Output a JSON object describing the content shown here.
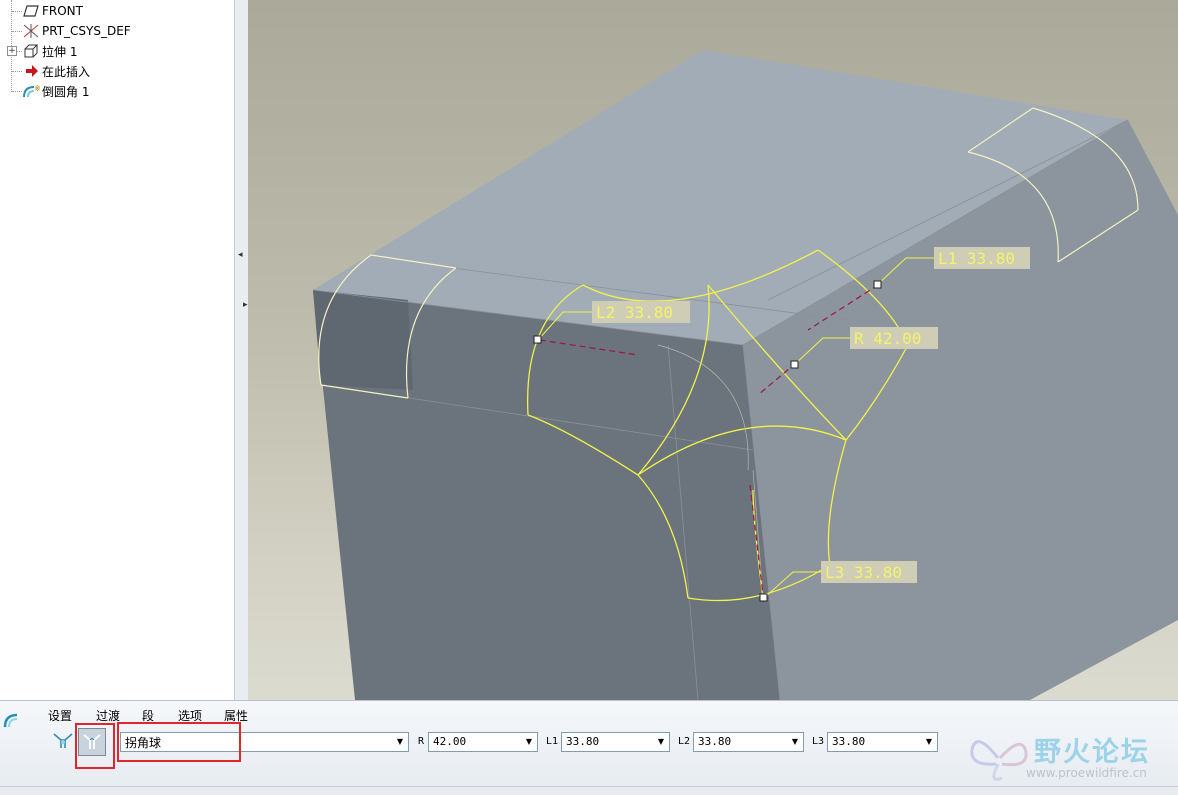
{
  "model_tree": {
    "items": [
      {
        "label": "FRONT",
        "icon": "datum-plane-icon"
      },
      {
        "label": "PRT_CSYS_DEF",
        "icon": "coordinate-system-icon"
      },
      {
        "label": "拉伸 1",
        "icon": "extrude-icon"
      },
      {
        "label": "在此插入",
        "icon": "insert-here-arrow-icon"
      },
      {
        "label": "倒圆角 1",
        "icon": "round-feature-icon"
      }
    ]
  },
  "viewport": {
    "dimensions": [
      {
        "label": "L1 33.80"
      },
      {
        "label": "L2 33.80"
      },
      {
        "label": "R 42.00"
      },
      {
        "label": "L3 33.80"
      }
    ],
    "colors": {
      "top_face": "#a2acb6",
      "front_face": "#6b737d",
      "right_face": "#8c959e",
      "edge_highlight": "#f2f24a",
      "dim_text_bg": "#cfcdb5",
      "dim_text": "#f4f46a"
    }
  },
  "dashboard": {
    "tabs": [
      "设置",
      "过渡",
      "段",
      "选项",
      "属性"
    ],
    "transition_type": "拐角球",
    "fields": [
      {
        "label": "R",
        "value": "42.00"
      },
      {
        "label": "L1",
        "value": "33.80"
      },
      {
        "label": "L2",
        "value": "33.80"
      },
      {
        "label": "L3",
        "value": "33.80"
      }
    ]
  },
  "watermark": {
    "title": "野火论坛",
    "url": "www.proewildfire.cn"
  }
}
